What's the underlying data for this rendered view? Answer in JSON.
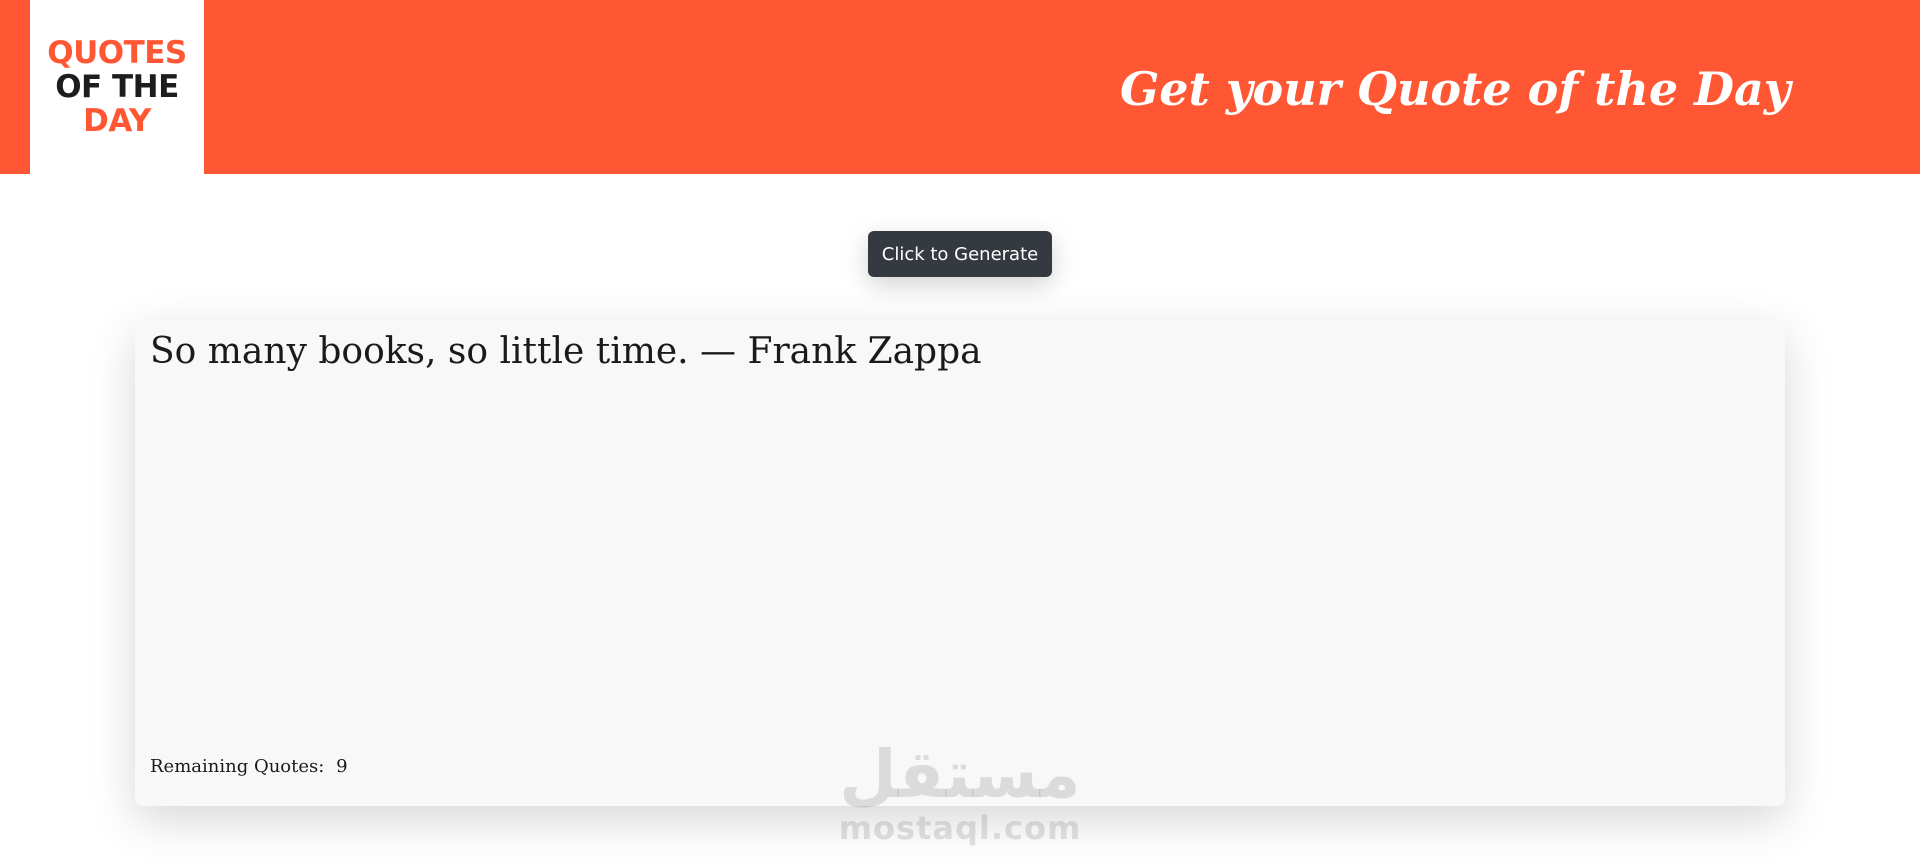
{
  "header": {
    "logo": {
      "line1": "QUOTES",
      "line2": "OF THE",
      "line3": "DAY"
    },
    "title": "Get your Quote of the Day"
  },
  "generate_button": {
    "label": "Click to Generate"
  },
  "quote_card": {
    "quote": "So many books, so little time. — Frank Zappa",
    "remaining_label": "Remaining Quotes:",
    "remaining_count": "9"
  },
  "watermark": {
    "arabic": "مستقل",
    "latin": "mostaql.com"
  },
  "colors": {
    "header_background": "#FF5733",
    "logo_accent": "#FF5733",
    "logo_dark": "#1d1d1f",
    "button_background": "#343a40",
    "card_background": "#f8f8f8"
  }
}
